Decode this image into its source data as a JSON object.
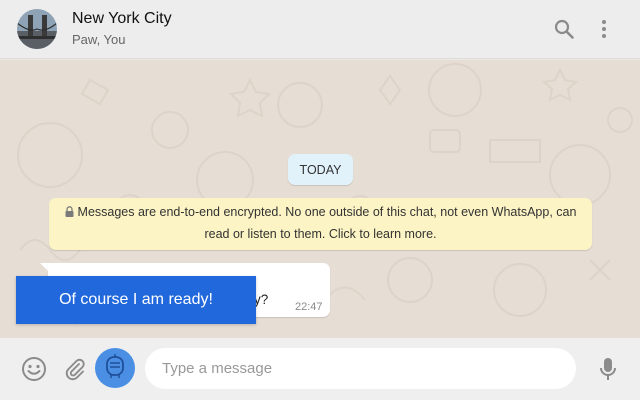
{
  "header": {
    "title": "New York City",
    "subtitle": "Paw, You"
  },
  "chat": {
    "date_chip": "TODAY",
    "encryption_notice": "Messages are end-to-end encrypted. No one outside of this chat, not even WhatsApp, can read or listen to them. Click to learn more.",
    "message": {
      "visible_text": "y?",
      "time": "22:47"
    }
  },
  "overlay_button": {
    "label": "Of course I am ready!"
  },
  "composer": {
    "placeholder": "Type a message"
  },
  "colors": {
    "header_bg": "#ededed",
    "chat_bg": "#e6ddd4",
    "notice_bg": "#fcf4c4",
    "date_chip_bg": "#e1f2fb",
    "overlay_button_bg": "#2168dc",
    "robot_button_bg": "#4a8fe3"
  },
  "icons": {
    "header": [
      "search-icon",
      "more-vert-icon"
    ],
    "composer": [
      "emoji-icon",
      "paperclip-icon",
      "robot-icon",
      "microphone-icon"
    ],
    "notice": "lock-icon"
  }
}
